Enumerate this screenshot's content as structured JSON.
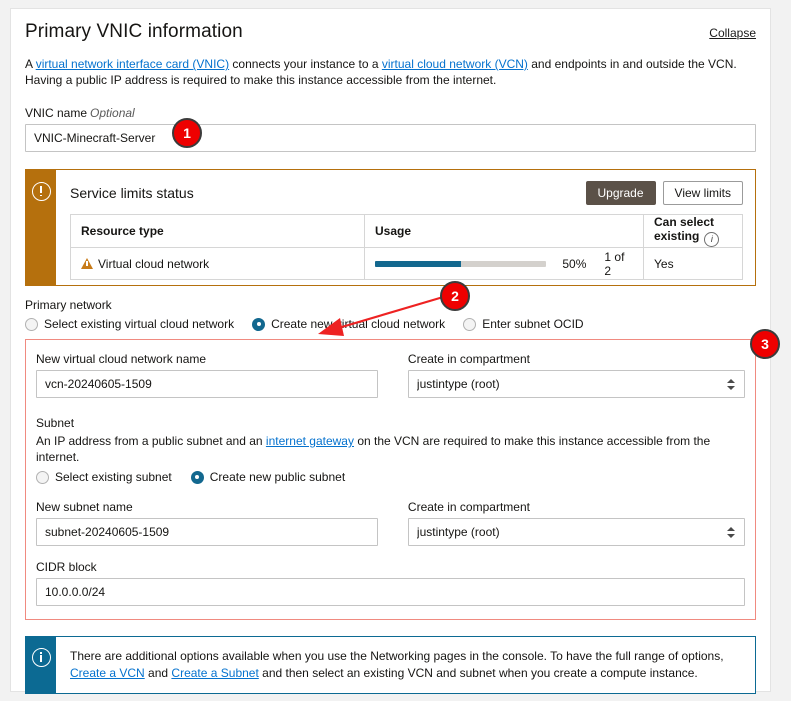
{
  "header": {
    "title": "Primary VNIC information",
    "collapse_label": "Collapse"
  },
  "intro": {
    "text_1": "A ",
    "link_vnic": "virtual network interface card (VNIC)",
    "text_2": " connects your instance to a ",
    "link_vcn": "virtual cloud network (VCN)",
    "text_3": " and endpoints in and outside the VCN. Having a public IP address is required to make this instance accessible from the internet."
  },
  "vnic_name": {
    "label": "VNIC name",
    "optional": "Optional",
    "value": "VNIC-Minecraft-Server",
    "placeholder": ""
  },
  "service_limits": {
    "icon": "exclamation-circle-icon",
    "title": "Service limits status",
    "upgrade_label": "Upgrade",
    "view_limits_label": "View limits",
    "columns": [
      "Resource type",
      "Usage",
      "Can select existing"
    ],
    "info_glyph": "i",
    "rows": [
      {
        "resource_type": "Virtual cloud network",
        "usage_percent": 50,
        "usage_percent_label": "50%",
        "usage_count": "1 of 2",
        "can_select_existing": "Yes",
        "status_icon": "warning-triangle-icon"
      }
    ]
  },
  "primary_network": {
    "label": "Primary network",
    "options": [
      {
        "label": "Select existing virtual cloud network",
        "selected": false
      },
      {
        "label": "Create new virtual cloud network",
        "selected": true
      },
      {
        "label": "Enter subnet OCID",
        "selected": false
      }
    ]
  },
  "vcn": {
    "name_label": "New virtual cloud network name",
    "name_value": "vcn-20240605-1509",
    "compartment_label": "Create in compartment",
    "compartment_value": "justintype (root)"
  },
  "subnet": {
    "heading": "Subnet",
    "desc_1": "An IP address from a public subnet and an ",
    "desc_link": "internet gateway",
    "desc_2": " on the VCN are required to make this instance accessible from the internet.",
    "options": [
      {
        "label": "Select existing subnet",
        "selected": false
      },
      {
        "label": "Create new public subnet",
        "selected": true
      }
    ],
    "name_label": "New subnet name",
    "name_value": "subnet-20240605-1509",
    "compartment_label": "Create in compartment",
    "compartment_value": "justintype (root)",
    "cidr_label": "CIDR block",
    "cidr_value": "10.0.0.0/24"
  },
  "callout": {
    "icon": "info-circle-icon",
    "text_1": "There are additional options available when you use the Networking pages in the console. To have the full range of options, ",
    "link_1": "Create a VCN",
    "text_2": " and ",
    "link_2": "Create a Subnet",
    "text_3": " and then select an existing VCN and subnet when you create a compute instance."
  },
  "annotations": {
    "badge_1": "1",
    "badge_2": "2",
    "badge_3": "3"
  },
  "colors": {
    "accent_orange": "#b5700d",
    "accent_teal": "#13688f",
    "link_blue": "#0572ce",
    "annotation_red": "#ee0000",
    "highlight_box": "#f08a80",
    "button_primary": "#5b5148"
  }
}
